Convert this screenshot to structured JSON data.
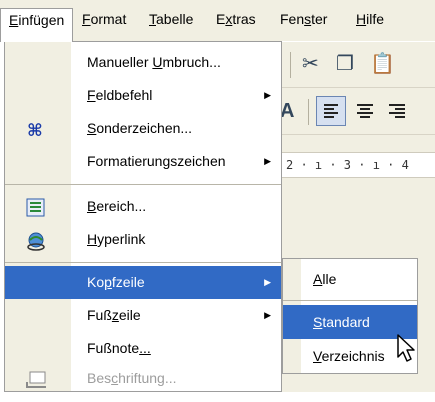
{
  "menubar": {
    "items": [
      {
        "label": "Einfügen",
        "acc": "E",
        "rest": "infügen"
      },
      {
        "label": "Format",
        "acc": "F",
        "rest": "ormat"
      },
      {
        "label": "Tabelle",
        "acc": "T",
        "rest": "abelle"
      },
      {
        "label": "Extras",
        "pre": "E",
        "acc": "x",
        "rest": "tras"
      },
      {
        "label": "Fenster",
        "pre": "Fen",
        "acc": "s",
        "rest": "ter"
      },
      {
        "label": "Hilfe",
        "acc": "H",
        "rest": "ilfe"
      }
    ]
  },
  "ruler": {
    "text": "2 · ı · 3 · ı · 4"
  },
  "menu": {
    "items": [
      {
        "pre": "Manueller ",
        "acc": "U",
        "rest": "mbruch..."
      },
      {
        "pre": "",
        "acc": "F",
        "rest": "eldbefehl"
      },
      {
        "pre": "",
        "acc": "S",
        "rest": "onderzeichen...",
        "icon": "special-character-icon"
      },
      {
        "pre": "Formatierun",
        "acc": "g",
        "rest": "szeichen"
      },
      {
        "pre": "",
        "acc": "B",
        "rest": "ereich...",
        "icon": "section-icon"
      },
      {
        "pre": "",
        "acc": "H",
        "rest": "yperlink",
        "icon": "hyperlink-icon"
      },
      {
        "pre": "Ko",
        "acc": "p",
        "rest": "fzeile"
      },
      {
        "pre": "Fuß",
        "acc": "z",
        "rest": "eile"
      },
      {
        "pre": "Fußnote",
        "acc": "",
        "rest": "..."
      },
      {
        "pre": "Bes",
        "acc": "c",
        "rest": "hriftung...",
        "icon": "caption-icon"
      }
    ]
  },
  "submenu": {
    "items": [
      {
        "pre": "",
        "acc": "A",
        "rest": "lle"
      },
      {
        "pre": "",
        "acc": "S",
        "rest": "tandard"
      },
      {
        "pre": "",
        "acc": "V",
        "rest": "erzeichnis"
      }
    ]
  },
  "colors": {
    "highlight": "#316ac5",
    "menu_strip": "#f1efe2",
    "disabled_text": "#9d9d9d"
  }
}
